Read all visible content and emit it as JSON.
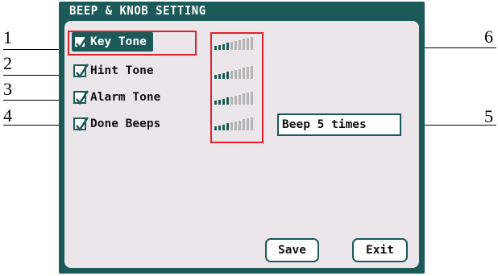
{
  "screen": {
    "title": "BEEP & KNOB SETTING",
    "accent_color": "#1b5a58",
    "panel_color": "#ebe6ea"
  },
  "options": [
    {
      "label": "Key Tone",
      "checked": true,
      "selected": true,
      "volume_level": 4,
      "volume_max": 10
    },
    {
      "label": "Hint Tone",
      "checked": true,
      "selected": false,
      "volume_level": 4,
      "volume_max": 10
    },
    {
      "label": "Alarm Tone",
      "checked": true,
      "selected": false,
      "volume_level": 4,
      "volume_max": 10
    },
    {
      "label": "Done Beeps",
      "checked": true,
      "selected": false,
      "volume_level": 4,
      "volume_max": 10
    }
  ],
  "done_beeps_value": "Beep 5 times",
  "buttons": {
    "save_label": "Save",
    "exit_label": "Exit"
  },
  "callouts": {
    "n1": "1",
    "n2": "2",
    "n3": "3",
    "n4": "4",
    "n5": "5",
    "n6": "6"
  },
  "highlight_color": "#e0202a",
  "volume_colors": {
    "filled": "#1b5a58",
    "empty": "#b3b3b3"
  }
}
